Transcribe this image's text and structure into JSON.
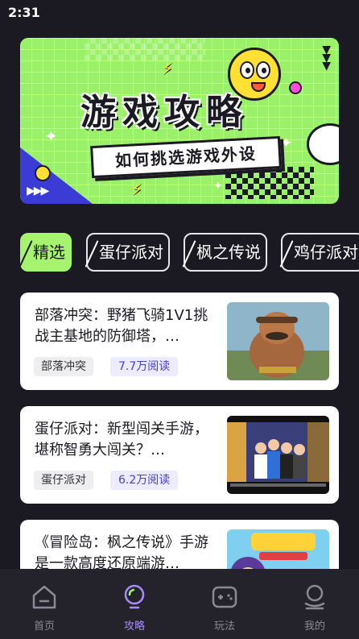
{
  "status_bar": {
    "time": "2:31"
  },
  "banner": {
    "title": "游戏攻略",
    "subtitle": "如何挑选游戏外设"
  },
  "tabs": [
    {
      "label": "精选",
      "active": true
    },
    {
      "label": "蛋仔派对",
      "active": false
    },
    {
      "label": "枫之传说",
      "active": false
    },
    {
      "label": "鸡仔派对",
      "active": false
    }
  ],
  "articles": [
    {
      "title": "部落冲突：野猪飞骑1V1挑战主基地的防御塔，…",
      "tag": "部落冲突",
      "reads": "7.7万阅读",
      "thumb_icon": "hog-rider-thumbnail"
    },
    {
      "title": "蛋仔派对：新型闯关手游，堪称智勇大闯关？…",
      "tag": "蛋仔派对",
      "reads": "6.2万阅读",
      "thumb_icon": "game-show-thumbnail"
    },
    {
      "title": "《冒险岛：枫之传说》手游是一款高度还原端游…",
      "tag": "",
      "reads": "",
      "thumb_icon": "maplestory-thumbnail"
    }
  ],
  "bottom_nav": [
    {
      "label": "首页",
      "icon": "home-icon",
      "active": false
    },
    {
      "label": "攻略",
      "icon": "bulb-icon",
      "active": true
    },
    {
      "label": "玩法",
      "icon": "gamepad-icon",
      "active": false
    },
    {
      "label": "我的",
      "icon": "profile-icon",
      "active": false
    }
  ],
  "colors": {
    "background": "#1b1a22",
    "accent_green": "#a6f36f",
    "accent_purple": "#a78bfa",
    "nav_bg": "#24232c"
  }
}
